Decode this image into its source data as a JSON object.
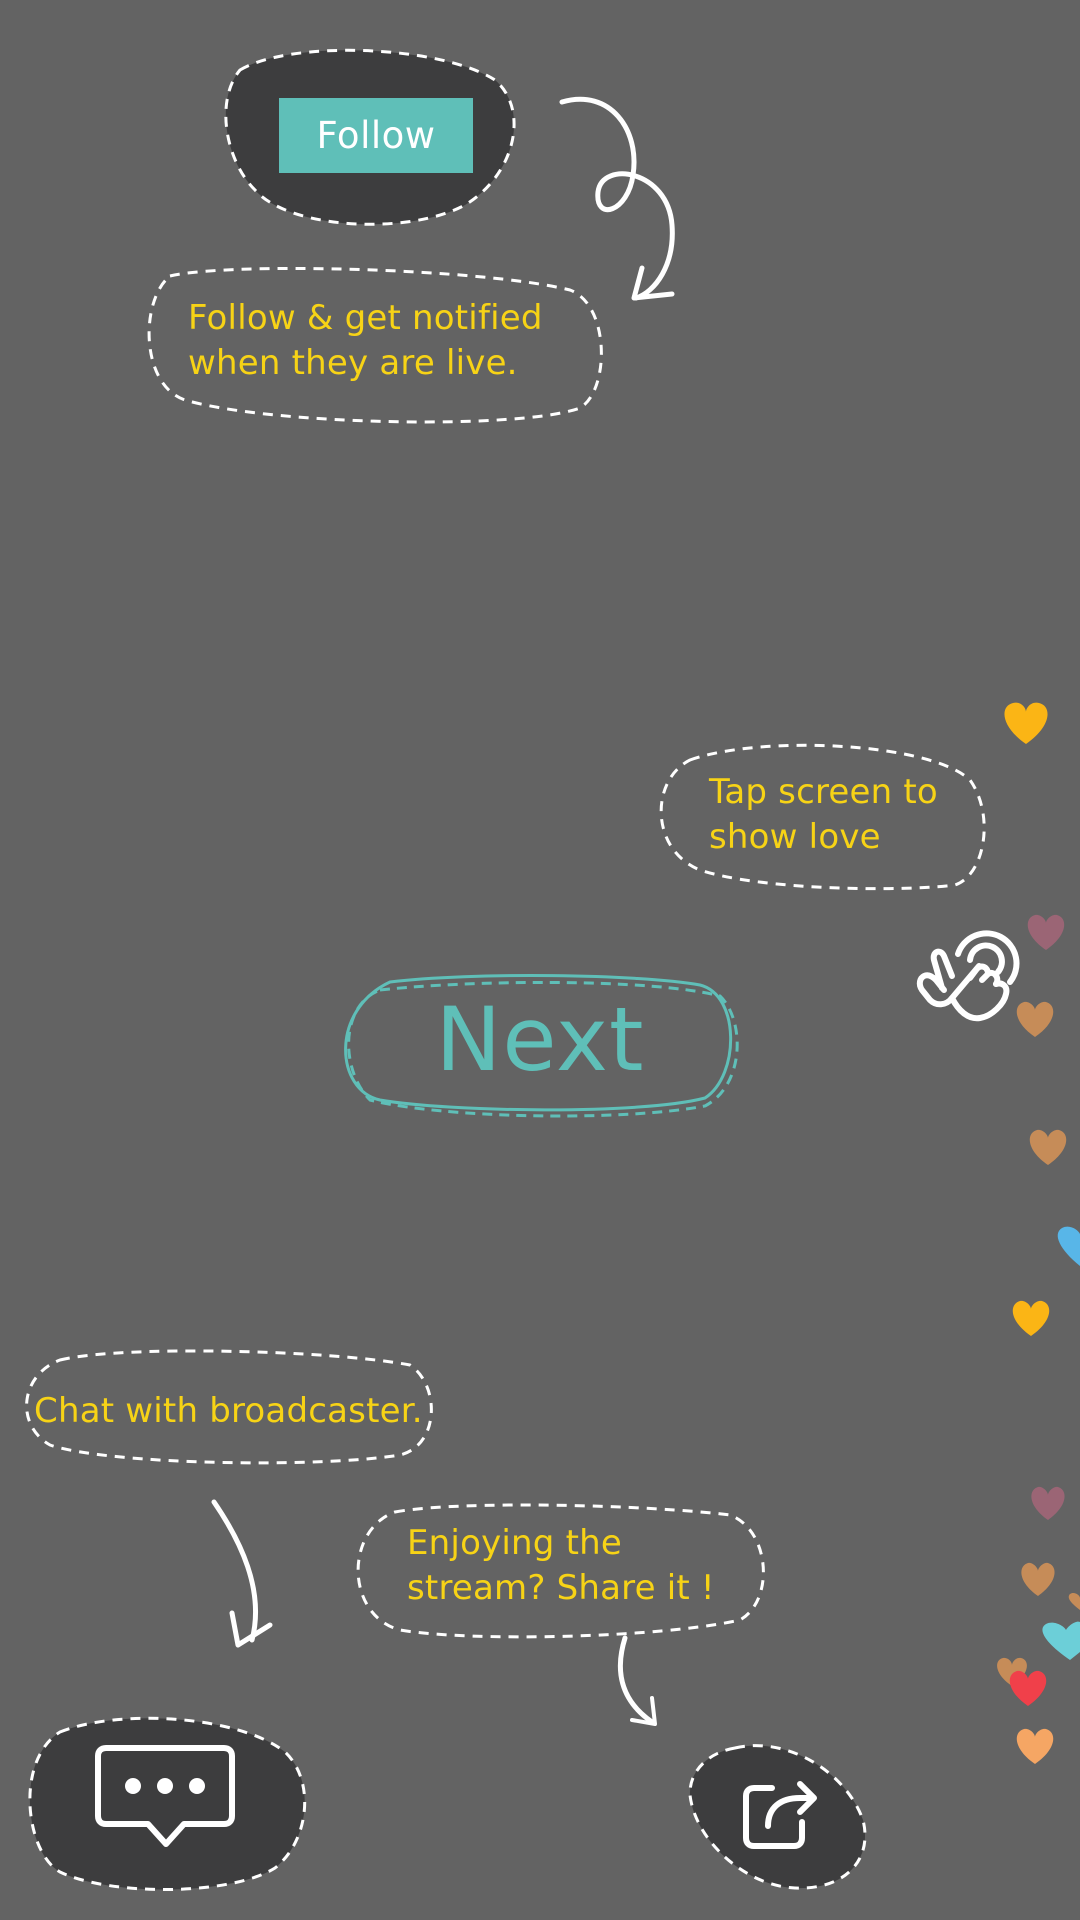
{
  "follow": {
    "button_label": "Follow",
    "hint": "Follow & get notified\nwhen they are live."
  },
  "love": {
    "hint": "Tap screen to\nshow love",
    "icon": "tap-hand-icon",
    "hearts": [
      "heart-icon"
    ]
  },
  "next": {
    "label": "Next"
  },
  "chat": {
    "hint": "Chat with broadcaster.",
    "icon": "chat-bubble-icon"
  },
  "share": {
    "hint": "Enjoying the\nstream? Share it !",
    "icon": "share-icon"
  },
  "colors": {
    "background": "#636363",
    "text_highlight": "#f7d316",
    "accent": "#5fbfb8",
    "blob": "#3d3d3e",
    "line": "#ffffff"
  }
}
